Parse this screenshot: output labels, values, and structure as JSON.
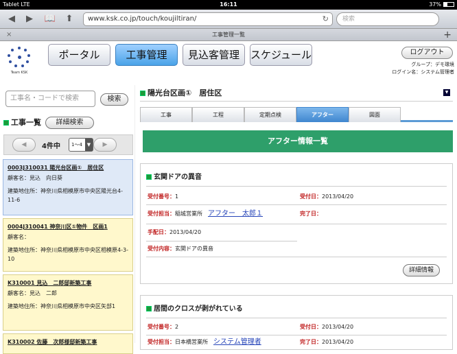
{
  "statusbar": {
    "carrier": "Tablet",
    "network": "LTE",
    "time": "16:11",
    "battery": "37%"
  },
  "browser": {
    "back": "◀",
    "forward": "▶",
    "bookmarks": "📖",
    "share": "⬆",
    "url": "www.ksk.co.jp/touch/koujiltiran/",
    "reload": "↻",
    "search_placeholder": "検索",
    "tab_title": "工事管理一覧",
    "tab_close": "×",
    "new_tab": "+"
  },
  "header": {
    "logo_text": "Team KSK",
    "nav": [
      {
        "label": "ポータル"
      },
      {
        "label": "工事管理"
      },
      {
        "label": "見込客管理"
      },
      {
        "label": "スケジュール"
      }
    ],
    "logout": "ログアウト",
    "group": "グループ：デモ環境",
    "login_name": "ログイン名：システム管理者"
  },
  "sidebar": {
    "search_placeholder": "工事名・コードで検索",
    "search_button": "検索",
    "list_title": "工事一覧",
    "detail_search": "詳細検索",
    "prev": "◀",
    "next": "▶",
    "count": "4件中",
    "range": "1〜4",
    "cards": [
      {
        "title": "0003J310031 陽光台区画①　居住区",
        "client": "顧客名：見込　向日葵",
        "address": "建築地住所：神奈川県相模原市中央区陽光台4-11-6",
        "bg": "#dfe9f7",
        "border": "#9bb8e3"
      },
      {
        "title": "0004J310041 神奈川区①物件　区画1",
        "client": "顧客名：",
        "address": "建築地住所：神奈川県相模原市中央区相模原4-3-10",
        "bg": "#fff8cc",
        "border": "#d9cf8a"
      },
      {
        "title": "K310001 見込　二郎邸新築工事",
        "client": "顧客名：見込　二郎",
        "address": "建築地住所：神奈川県相模原市中央区矢部1",
        "bg": "#fff8cc",
        "border": "#d9cf8a"
      },
      {
        "title": "K310002 佐藤　次郎様邸新築工事",
        "client": "",
        "address": "",
        "bg": "#fff8cc",
        "border": "#d9cf8a"
      }
    ]
  },
  "main": {
    "title": "陽光台区画①　居住区",
    "collapse_icon": "▼",
    "tabs": [
      {
        "label": "工事"
      },
      {
        "label": "工程"
      },
      {
        "label": "定期点検"
      },
      {
        "label": "アフター"
      },
      {
        "label": "図面"
      }
    ],
    "banner": "アフター情報一覧",
    "records": [
      {
        "title": "玄関ドアの異音",
        "no_label": "受付番号：",
        "no": "1",
        "date_label": "受付日：",
        "date": "2013/04/20",
        "staff_label": "受付担当：",
        "staff_dept": "稲城営業所",
        "staff_name": "アフター　太郎１",
        "done_label": "完了日：",
        "done": "",
        "arrange_label": "手配日：",
        "arrange": "2013/04/20",
        "content_label": "受付内容：",
        "content": "玄関ドアの異音",
        "detail_button": "詳細情報"
      },
      {
        "title": "居間のクロスが剥がれている",
        "no_label": "受付番号：",
        "no": "2",
        "date_label": "受付日：",
        "date": "2013/04/20",
        "staff_label": "受付担当：",
        "staff_dept": "日本橋営業所",
        "staff_name": "システム管理者",
        "done_label": "完了日：",
        "done": "2013/04/20"
      }
    ]
  }
}
